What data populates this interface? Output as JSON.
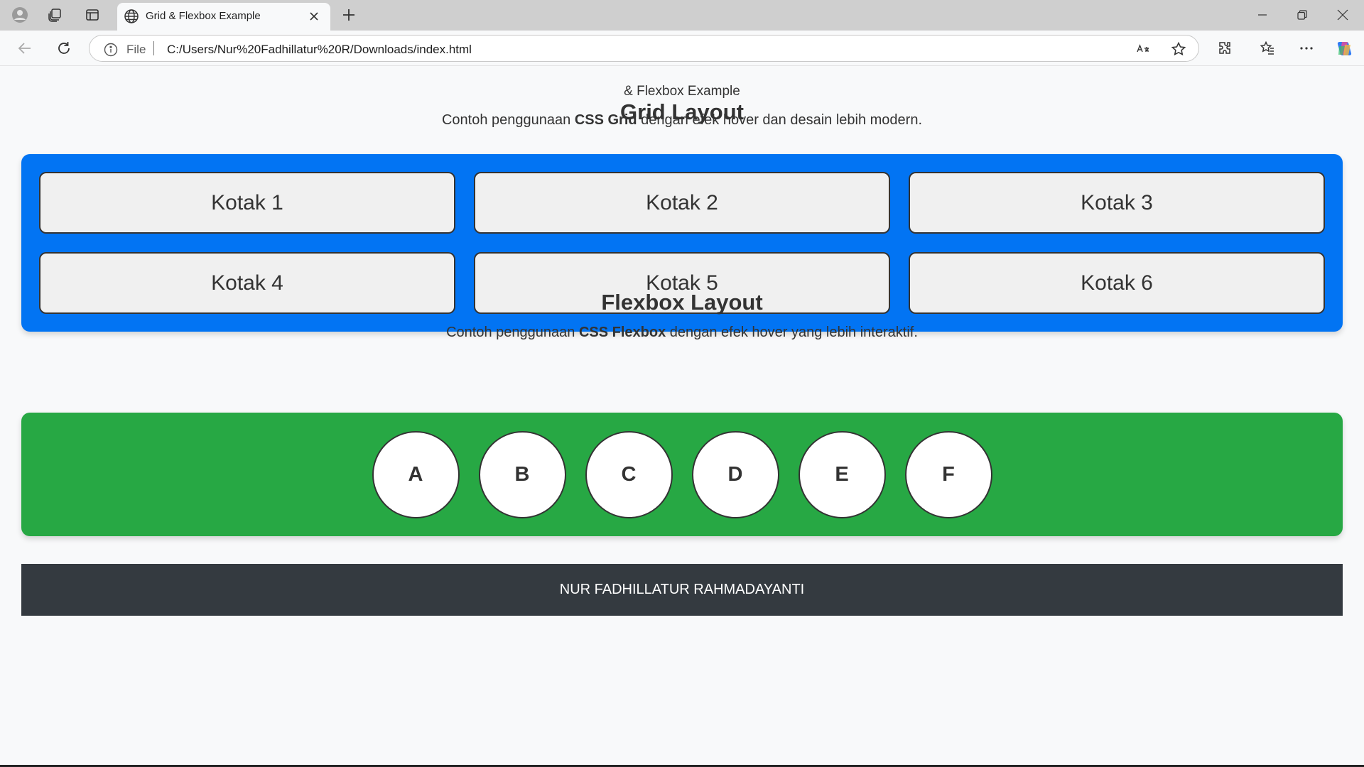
{
  "browser": {
    "tab_title": "Grid & Flexbox Example",
    "address": {
      "scheme_label": "File",
      "url": "C:/Users/Nur%20Fadhillatur%20R/Downloads/index.html"
    },
    "icons": [
      "profile-icon",
      "workspaces-icon",
      "tab-actions-icon",
      "globe-icon",
      "close-tab-icon",
      "new-tab-icon",
      "minimize-icon",
      "restore-icon",
      "close-window-icon",
      "back-icon",
      "refresh-icon",
      "info-icon",
      "read-aloud-icon",
      "favorite-star-icon",
      "extensions-icon",
      "favorites-icon",
      "more-icon",
      "copilot-icon"
    ]
  },
  "page": {
    "small_title": "& Flexbox Example",
    "grid_section": {
      "heading": "Grid Layout",
      "desc_before": "Contoh penggunaan ",
      "desc_bold": "CSS Grid",
      "desc_after": " dengan efek hover dan desain lebih modern.",
      "boxes": [
        "Kotak 1",
        "Kotak 2",
        "Kotak 3",
        "Kotak 4",
        "Kotak 5",
        "Kotak 6"
      ],
      "color": "#0274f3"
    },
    "flex_section": {
      "heading": "Flexbox Layout",
      "desc_before": "Contoh penggunaan ",
      "desc_bold": "CSS Flexbox",
      "desc_after": " dengan efek hover yang lebih interaktif.",
      "items": [
        "A",
        "B",
        "C",
        "D",
        "E",
        "F"
      ],
      "color": "#27a844"
    },
    "footer": "NUR FADHILLATUR RAHMADAYANTI"
  }
}
